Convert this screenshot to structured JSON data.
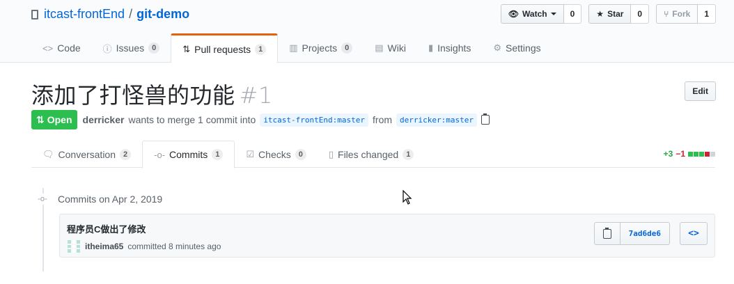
{
  "repo": {
    "owner": "itcast-frontEnd",
    "separator": "/",
    "name": "git-demo"
  },
  "actions": {
    "watch": {
      "label": "Watch",
      "count": "0",
      "icon": "eye-icon"
    },
    "star": {
      "label": "Star",
      "count": "0",
      "icon": "star-icon"
    },
    "fork": {
      "label": "Fork",
      "count": "1",
      "icon": "fork-icon"
    }
  },
  "repo_nav": [
    {
      "label": "Code",
      "icon": "code-icon"
    },
    {
      "label": "Issues",
      "count": "0",
      "icon": "issue-icon"
    },
    {
      "label": "Pull requests",
      "count": "1",
      "icon": "pull-request-icon"
    },
    {
      "label": "Projects",
      "count": "0",
      "icon": "project-icon"
    },
    {
      "label": "Wiki",
      "icon": "book-icon"
    },
    {
      "label": "Insights",
      "icon": "graph-icon"
    },
    {
      "label": "Settings",
      "icon": "gear-icon"
    }
  ],
  "pr": {
    "title": "添加了打怪兽的功能",
    "number": "#1",
    "edit_label": "Edit",
    "state": "Open",
    "author": "derricker",
    "merge_text": "wants to merge 1 commit into",
    "base_branch": "itcast-frontEnd:master",
    "from_text": "from",
    "head_branch": "derricker:master"
  },
  "pr_tabs": [
    {
      "label": "Conversation",
      "count": "2",
      "icon": "comment-icon"
    },
    {
      "label": "Commits",
      "count": "1",
      "icon": "commit-icon"
    },
    {
      "label": "Checks",
      "count": "0",
      "icon": "checklist-icon"
    },
    {
      "label": "Files changed",
      "count": "1",
      "icon": "file-diff-icon"
    }
  ],
  "diffstat": {
    "additions": "+3",
    "deletions": "−1"
  },
  "commits": {
    "date_heading": "Commits on Apr 2, 2019",
    "items": [
      {
        "message": "程序员C做出了修改",
        "author": "itheima65",
        "when": "committed 8 minutes ago",
        "sha": "7ad6de6",
        "browse_label": "<>"
      }
    ]
  },
  "colors": {
    "accent": "#e36209",
    "open_green": "#2cbe4e",
    "link": "#0366d6"
  }
}
